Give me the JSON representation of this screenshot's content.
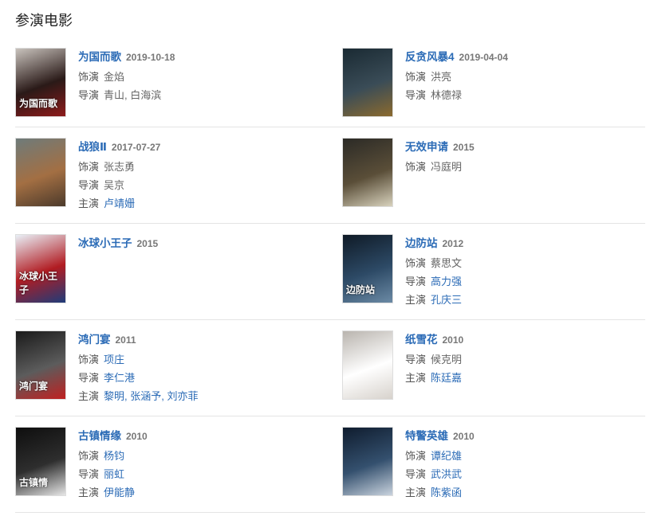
{
  "section": {
    "title": "参演电影"
  },
  "movies": [
    {
      "title": "为国而歌",
      "date": "2019-10-18",
      "roles": [
        {
          "label": "饰演",
          "value": "金焰",
          "link": false
        },
        {
          "label": "导演",
          "value": "青山, 白海滨",
          "link": false
        }
      ],
      "poster_colors": [
        "#c9c3bd",
        "#2a1a18",
        "#8e1b1b"
      ],
      "poster_text": "为国而歌"
    },
    {
      "title": "反贪风暴4",
      "date": "2019-04-04",
      "roles": [
        {
          "label": "饰演",
          "value": "洪亮",
          "link": false
        },
        {
          "label": "导演",
          "value": "林德禄",
          "link": false
        }
      ],
      "poster_colors": [
        "#1a2a33",
        "#3a4c57",
        "#8b6a2e"
      ],
      "poster_text": ""
    },
    {
      "title": "战狼Ⅱ",
      "date": "2017-07-27",
      "roles": [
        {
          "label": "饰演",
          "value": "张志勇",
          "link": false
        },
        {
          "label": "导演",
          "value": "吴京",
          "link": false
        },
        {
          "label": "主演",
          "value": "卢靖姗",
          "link": true
        }
      ],
      "poster_colors": [
        "#6e7b7a",
        "#a36f43",
        "#4c3a2b"
      ],
      "poster_text": ""
    },
    {
      "title": "无效申请",
      "date": "2015",
      "roles": [
        {
          "label": "饰演",
          "value": "冯庭明",
          "link": false
        }
      ],
      "poster_colors": [
        "#2b2a26",
        "#5a4e38",
        "#d8d2bd"
      ],
      "poster_text": ""
    },
    {
      "title": "冰球小王子",
      "date": "2015",
      "roles": [],
      "poster_colors": [
        "#e9f0f7",
        "#b11c22",
        "#1f3c7a"
      ],
      "poster_text": "冰球小王子"
    },
    {
      "title": "边防站",
      "date": "2012",
      "roles": [
        {
          "label": "饰演",
          "value": "蔡思文",
          "link": false
        },
        {
          "label": "导演",
          "value": "高力强",
          "link": true
        },
        {
          "label": "主演",
          "value": "孔庆三",
          "link": true
        }
      ],
      "poster_colors": [
        "#0f1a26",
        "#2d4a66",
        "#6b8aa5"
      ],
      "poster_text": "边防站"
    },
    {
      "title": "鸿门宴",
      "date": "2011",
      "roles": [
        {
          "label": "饰演",
          "value": "项庄",
          "link": true
        },
        {
          "label": "导演",
          "value": "李仁港",
          "link": true
        },
        {
          "label": "主演",
          "value": "黎明, 张涵予, 刘亦菲",
          "link": true
        }
      ],
      "poster_colors": [
        "#1a1a1a",
        "#5c5c5c",
        "#c02020"
      ],
      "poster_text": "鸿门宴"
    },
    {
      "title": "纸雪花",
      "date": "2010",
      "roles": [
        {
          "label": "导演",
          "value": "候克明",
          "link": false
        },
        {
          "label": "主演",
          "value": "陈廷嘉",
          "link": true
        }
      ],
      "poster_colors": [
        "#b9b4ae",
        "#ffffff",
        "#d7d2cc"
      ],
      "poster_text": ""
    },
    {
      "title": "古镇情缘",
      "date": "2010",
      "roles": [
        {
          "label": "饰演",
          "value": "杨钧",
          "link": true
        },
        {
          "label": "导演",
          "value": "丽虹",
          "link": true
        },
        {
          "label": "主演",
          "value": "伊能静",
          "link": true
        }
      ],
      "poster_colors": [
        "#0e0e0e",
        "#2e2e2e",
        "#e6e6e6"
      ],
      "poster_text": "古镇情"
    },
    {
      "title": "特警英雄",
      "date": "2010",
      "roles": [
        {
          "label": "饰演",
          "value": "谭纪雄",
          "link": true
        },
        {
          "label": "导演",
          "value": "武洪武",
          "link": true
        },
        {
          "label": "主演",
          "value": "陈紫函",
          "link": true
        }
      ],
      "poster_colors": [
        "#0f1c2e",
        "#34506e",
        "#c9d3de"
      ],
      "poster_text": ""
    }
  ]
}
